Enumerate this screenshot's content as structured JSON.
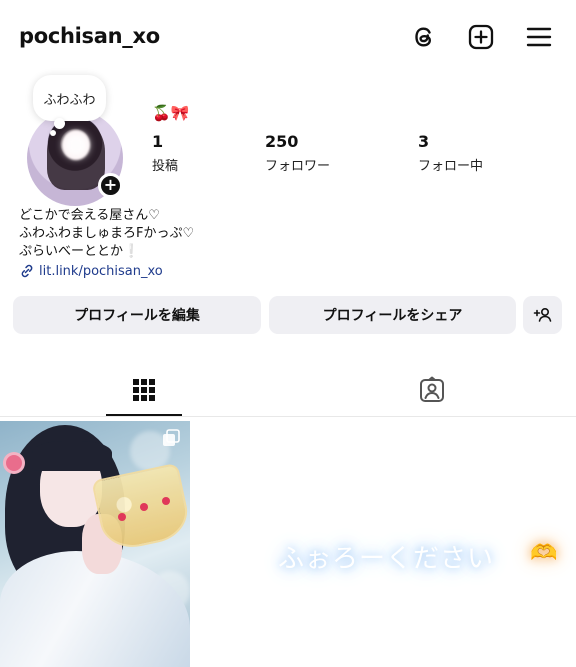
{
  "header": {
    "username": "pochisan_xo",
    "icons": [
      "threads-icon",
      "add-post-icon",
      "menu-icon"
    ]
  },
  "profile": {
    "note": "ふわふわ",
    "emoji": "🍒🎀",
    "stats": [
      {
        "count": "1",
        "label": "投稿"
      },
      {
        "count": "250",
        "label": "フォロワー"
      },
      {
        "count": "3",
        "label": "フォロー中"
      }
    ],
    "bio": [
      "どこかで会える屋さん♡",
      "ふわふわましゅまろFかっぷ♡",
      "ぷらいべーととか❕"
    ],
    "link": "lit.link/pochisan_xo"
  },
  "buttons": {
    "edit_profile": "プロフィールを編集",
    "share_profile": "プロフィールをシェア"
  },
  "tabs": [
    "grid-icon",
    "tagged-icon"
  ],
  "grid": {
    "overlay_text": "ふぉろーください",
    "overlay_heart": "🫶"
  },
  "colors": {
    "link": "#1f3b8c",
    "button_bg": "#efeff3"
  }
}
